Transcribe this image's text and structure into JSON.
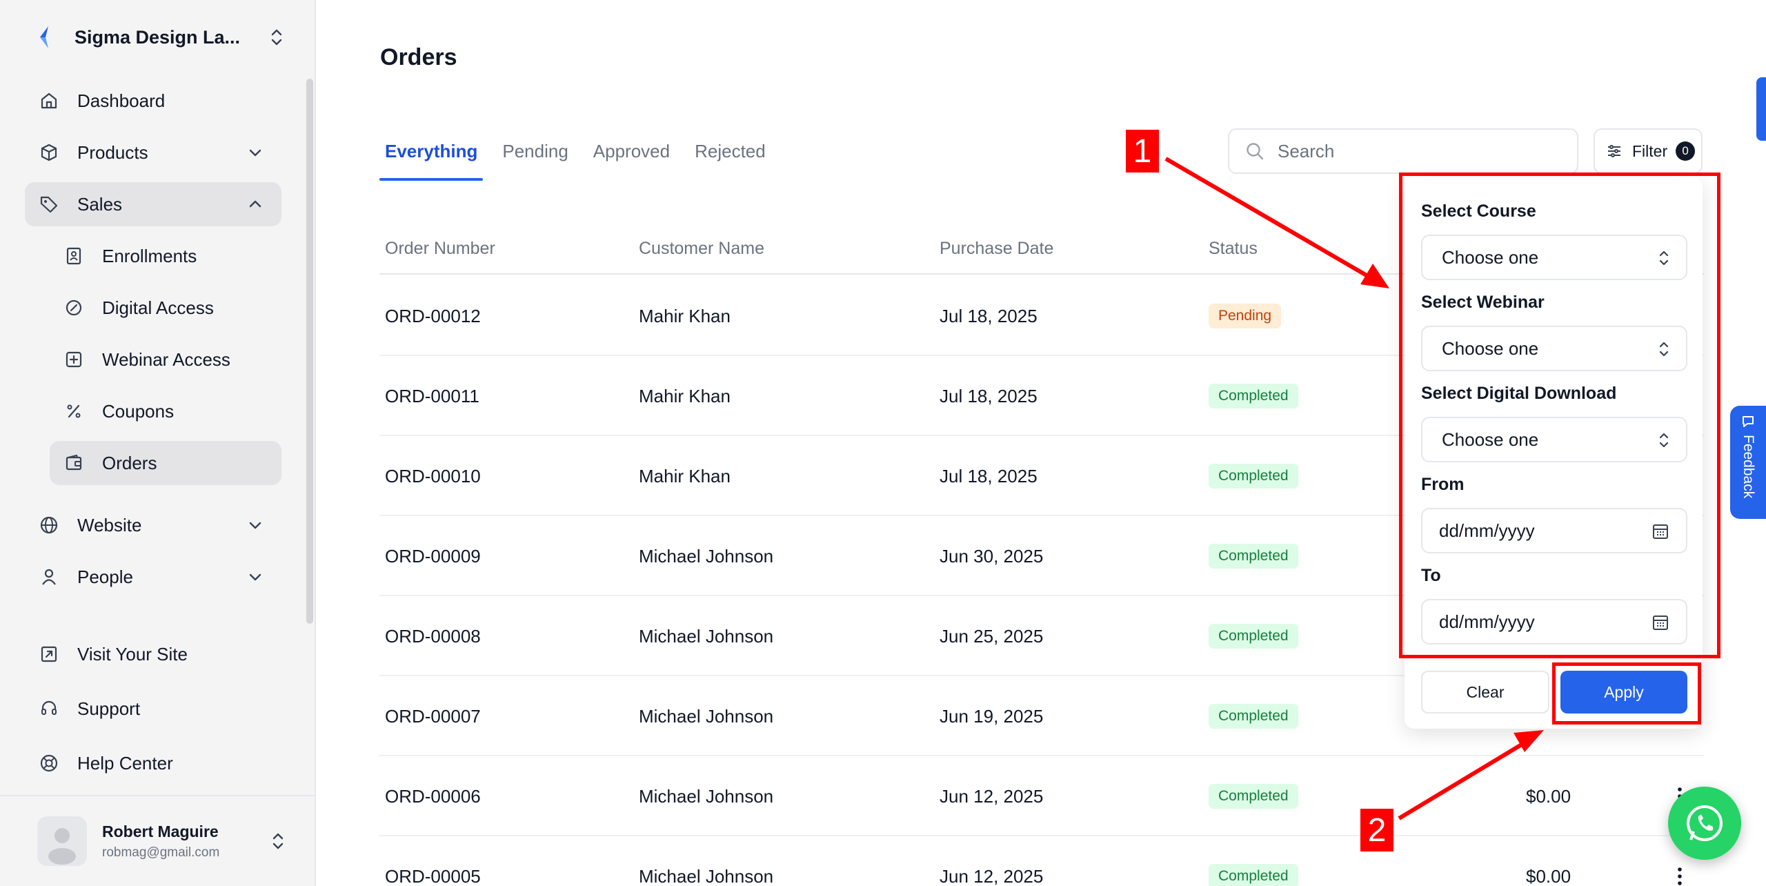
{
  "sidebar": {
    "brand": "Sigma Design La...",
    "nav": [
      {
        "label": "Dashboard",
        "icon": "home-icon"
      },
      {
        "label": "Products",
        "icon": "box-icon"
      },
      {
        "label": "Sales",
        "icon": "tag-icon"
      },
      {
        "label": "Enrollments",
        "icon": "contact-card-icon"
      },
      {
        "label": "Digital Access",
        "icon": "gauge-icon"
      },
      {
        "label": "Webinar Access",
        "icon": "plus-square-icon"
      },
      {
        "label": "Coupons",
        "icon": "percent-icon"
      },
      {
        "label": "Orders",
        "icon": "wallet-icon"
      },
      {
        "label": "Website",
        "icon": "globe-icon"
      },
      {
        "label": "People",
        "icon": "user-icon"
      }
    ],
    "footer_links": [
      {
        "label": "Visit Your Site",
        "icon": "external-link-icon"
      },
      {
        "label": "Support",
        "icon": "headset-icon"
      },
      {
        "label": "Help Center",
        "icon": "lifebuoy-icon"
      }
    ],
    "user": {
      "name": "Robert Maguire",
      "email": "robmag@gmail.com"
    }
  },
  "main": {
    "title": "Orders",
    "tabs": [
      "Everything",
      "Pending",
      "Approved",
      "Rejected"
    ],
    "active_tab": "Everything",
    "search": {
      "placeholder": "Search"
    },
    "filter": {
      "label": "Filter",
      "count": "0"
    },
    "columns": [
      "Order Number",
      "Customer Name",
      "Purchase Date",
      "Status"
    ],
    "rows": [
      {
        "order": "ORD-00012",
        "customer": "Mahir Khan",
        "date": "Jul 18, 2025",
        "status": "Pending",
        "amount": ""
      },
      {
        "order": "ORD-00011",
        "customer": "Mahir Khan",
        "date": "Jul 18, 2025",
        "status": "Completed",
        "amount": ""
      },
      {
        "order": "ORD-00010",
        "customer": "Mahir Khan",
        "date": "Jul 18, 2025",
        "status": "Completed",
        "amount": ""
      },
      {
        "order": "ORD-00009",
        "customer": "Michael Johnson",
        "date": "Jun 30, 2025",
        "status": "Completed",
        "amount": ""
      },
      {
        "order": "ORD-00008",
        "customer": "Michael Johnson",
        "date": "Jun 25, 2025",
        "status": "Completed",
        "amount": ""
      },
      {
        "order": "ORD-00007",
        "customer": "Michael Johnson",
        "date": "Jun 19, 2025",
        "status": "Completed",
        "amount": ""
      },
      {
        "order": "ORD-00006",
        "customer": "Michael Johnson",
        "date": "Jun 12, 2025",
        "status": "Completed",
        "amount": "$0.00"
      },
      {
        "order": "ORD-00005",
        "customer": "Michael Johnson",
        "date": "Jun 12, 2025",
        "status": "Completed",
        "amount": "$0.00"
      }
    ]
  },
  "filter_panel": {
    "course_label": "Select Course",
    "course_value": "Choose one",
    "webinar_label": "Select Webinar",
    "webinar_value": "Choose one",
    "download_label": "Select Digital Download",
    "download_value": "Choose one",
    "from_label": "From",
    "from_placeholder": "dd/mm/yyyy",
    "to_label": "To",
    "to_placeholder": "dd/mm/yyyy",
    "clear_label": "Clear",
    "apply_label": "Apply"
  },
  "annotations": {
    "label1": "1",
    "label2": "2",
    "color": "#ff0000"
  },
  "feedback": {
    "label": "Feedback"
  },
  "colors": {
    "accent": "#2563eb",
    "pending_bg": "#ffedd5",
    "completed_bg": "#dcfce7",
    "whatsapp": "#25d366"
  }
}
